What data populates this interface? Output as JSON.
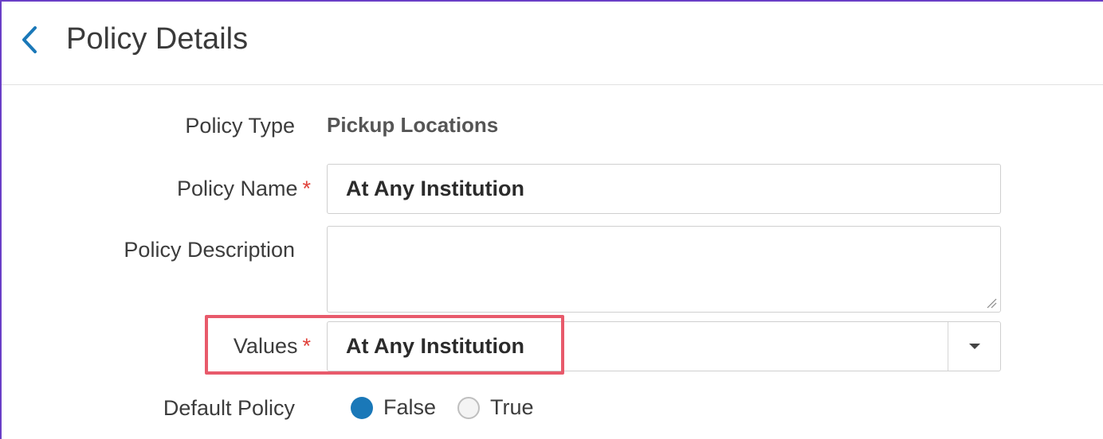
{
  "header": {
    "title": "Policy Details",
    "back_icon": "chevron-left-icon"
  },
  "form": {
    "policy_type": {
      "label": "Policy Type",
      "value": "Pickup Locations"
    },
    "policy_name": {
      "label": "Policy Name",
      "required_mark": "*",
      "value": "At Any Institution"
    },
    "policy_description": {
      "label": "Policy Description",
      "value": ""
    },
    "values": {
      "label": "Values",
      "required_mark": "*",
      "selected": "At Any Institution"
    },
    "default_policy": {
      "label": "Default Policy",
      "options": [
        {
          "label": "False",
          "checked": true
        },
        {
          "label": "True",
          "checked": false
        }
      ]
    }
  },
  "colors": {
    "accent": "#1a78b8",
    "required": "#e0413a",
    "highlight": "#e85a6b",
    "frame": "#6a3fc7"
  }
}
